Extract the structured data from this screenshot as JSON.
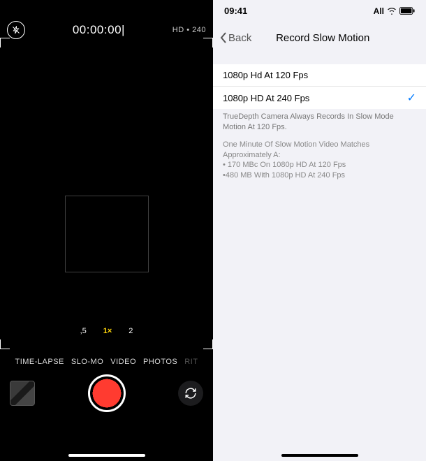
{
  "left": {
    "flash_icon": "flash-off",
    "timer": "00:00:00|",
    "format": "HD • 240",
    "zoom": {
      "options": [
        ",5",
        "1×",
        "2"
      ],
      "selected_index": 1
    },
    "modes": [
      "TIME-LAPSE",
      "SLO-MO",
      "VIDEO",
      "PHOTOS",
      "RIT"
    ],
    "active_mode_index": 1
  },
  "right": {
    "status": {
      "time": "09:41",
      "carrier": "All"
    },
    "nav": {
      "back": "Back",
      "title": "Record Slow Motion"
    },
    "options": [
      {
        "label": "1080p Hd At 120 Fps",
        "selected": false
      },
      {
        "label": "1080p HD At 240 Fps",
        "selected": true
      }
    ],
    "info": {
      "line1": "TrueDepth Camera Always Records In Slow Mode Motion At 120 Fps.",
      "line2": "One Minute Of Slow Motion Video Matches Approximately A:",
      "bullet1": "•  170 MBc On 1080p HD At 120 Fps",
      "bullet2": "•480 MB With 1080p HD At 240 Fps"
    }
  }
}
